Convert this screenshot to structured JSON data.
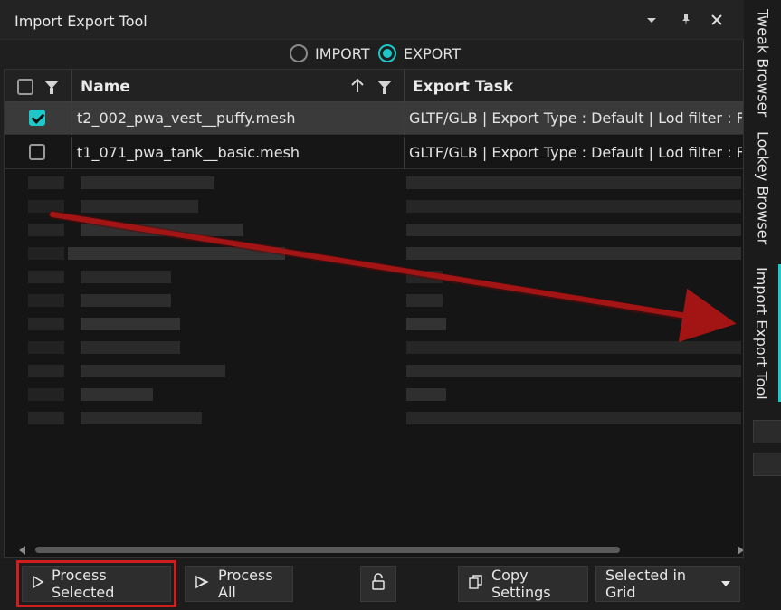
{
  "window": {
    "title": "Import Export Tool",
    "icons": [
      "dropdown-icon",
      "pin-icon",
      "close-icon"
    ]
  },
  "mode": {
    "options": [
      {
        "label": "IMPORT",
        "selected": false
      },
      {
        "label": "EXPORT",
        "selected": true
      }
    ]
  },
  "grid": {
    "columns": {
      "name": "Name",
      "export_task": "Export Task"
    },
    "rows": [
      {
        "checked": true,
        "name": "t2_002_pwa_vest__puffy.mesh",
        "export_task": "GLTF/GLB | Export Type : Default | Lod filter : False | "
      },
      {
        "checked": false,
        "name": "t1_071_pwa_tank__basic.mesh",
        "export_task": "GLTF/GLB | Export Type : Default | Lod filter : False | "
      }
    ]
  },
  "footer": {
    "process_selected": "Process Selected",
    "process_all": "Process All",
    "copy_settings": "Copy Settings",
    "scope_select": "Selected in Grid"
  },
  "side_tabs": [
    {
      "label": "Tweak Browser",
      "active": false
    },
    {
      "label": "Lockey Browser",
      "active": false
    },
    {
      "label": "Import Export Tool",
      "active": true
    }
  ],
  "colors": {
    "accent": "#1ec8c8",
    "highlight_box": "#d01d1d",
    "annotation_arrow": "#a31414"
  }
}
